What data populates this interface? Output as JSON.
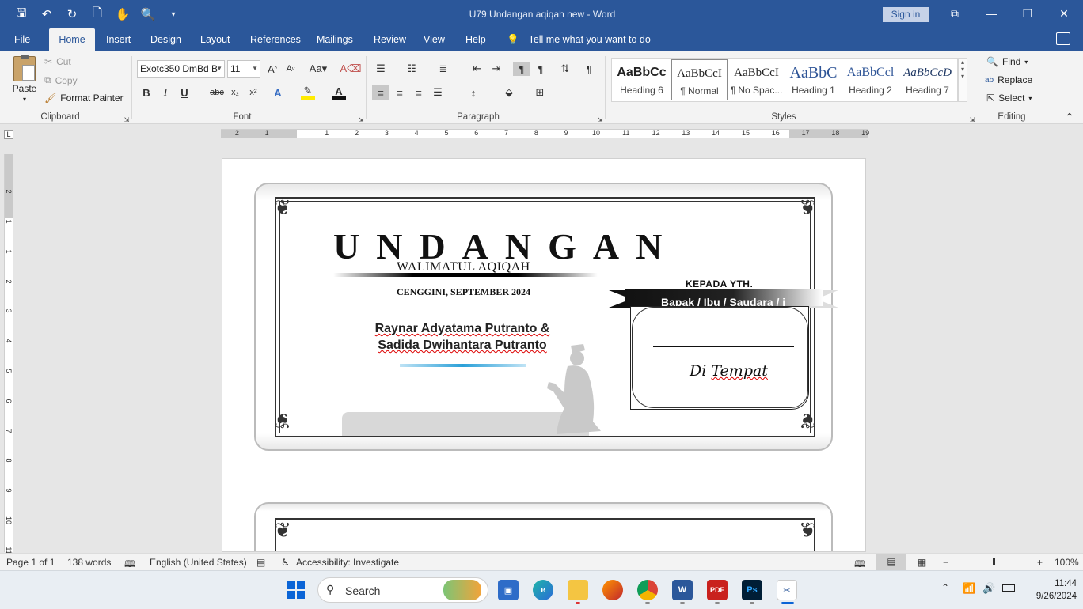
{
  "window": {
    "title": "U79 Undangan aqiqah new  -  Word",
    "sign_in": "Sign in"
  },
  "tabs": [
    "File",
    "Home",
    "Insert",
    "Design",
    "Layout",
    "References",
    "Mailings",
    "Review",
    "View",
    "Help"
  ],
  "tell_me": "Tell me what you want to do",
  "clipboard": {
    "paste": "Paste",
    "cut": "Cut",
    "copy": "Copy",
    "format_painter": "Format Painter",
    "group": "Clipboard"
  },
  "font": {
    "name": "Exotc350 DmBd B",
    "size": "11",
    "group": "Font"
  },
  "paragraph": {
    "group": "Paragraph"
  },
  "styles": {
    "group": "Styles",
    "tiles": [
      {
        "sample": "AaBbCc",
        "name": "Heading 6"
      },
      {
        "sample": "AaBbCcI",
        "name": "¶ Normal"
      },
      {
        "sample": "AaBbCcI",
        "name": "¶ No Spac..."
      },
      {
        "sample": "AaBbC",
        "name": "Heading 1"
      },
      {
        "sample": "AaBbCcl",
        "name": "Heading 2"
      },
      {
        "sample": "AaBbCcD",
        "name": "Heading 7"
      }
    ]
  },
  "editing": {
    "find": "Find",
    "replace": "Replace",
    "select": "Select",
    "group": "Editing"
  },
  "ruler": {
    "h_numbers": [
      "2",
      "1",
      "1",
      "2",
      "3",
      "4",
      "5",
      "6",
      "7",
      "8",
      "9",
      "10",
      "11",
      "12",
      "13",
      "14",
      "15",
      "16",
      "17",
      "18",
      "19"
    ],
    "v_numbers": [
      "2",
      "1",
      "1",
      "2",
      "3",
      "4",
      "5",
      "6",
      "7",
      "8",
      "9",
      "10",
      "11"
    ]
  },
  "invitation": {
    "title": "UNDANGAN",
    "subtitle": "WALIMATUL AQIQAH",
    "date": "CENGGINI, SEPTEMBER 2024",
    "name1": "Raynar Adyatama Putranto &",
    "name2": "Sadida Dwihantara Putranto",
    "kepada": "KEPADA YTH.",
    "recipient_prefix": "Bapak / Ibu / ",
    "recipient_underlined": "Saudara",
    "recipient_suffix": " / i",
    "ditempat_a": "Di ",
    "ditempat_b": "Tempat"
  },
  "status": {
    "page": "Page 1 of 1",
    "words": "138 words",
    "language": "English (United States)",
    "accessibility": "Accessibility: Investigate",
    "zoom": "100%"
  },
  "taskbar": {
    "search": "Search",
    "time": "11:44",
    "date": "9/26/2024"
  },
  "colors": {
    "word_blue": "#2b579a",
    "ribbon_bg": "#f3f3f3"
  }
}
